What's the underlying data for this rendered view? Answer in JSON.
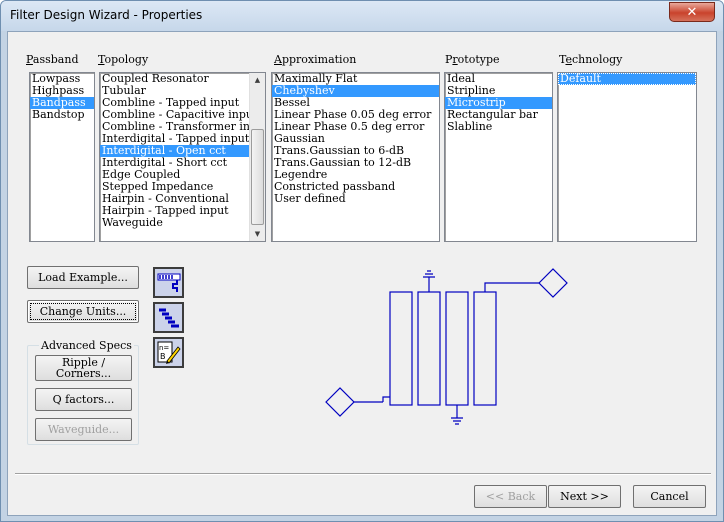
{
  "window": {
    "title": "Filter Design Wizard - Properties",
    "close_glyph": "✕"
  },
  "columns": {
    "passband": {
      "label": "Passband",
      "hotkey": "P",
      "items": [
        "Lowpass",
        "Highpass",
        "Bandpass",
        "Bandstop"
      ],
      "selected": "Bandpass"
    },
    "topology": {
      "label": "Topology",
      "hotkey": "T",
      "items": [
        "Coupled Resonator",
        "Tubular",
        "Combline - Tapped input",
        "Combline - Capacitive input",
        "Combline - Transformer input",
        "Interdigital - Tapped input",
        "Interdigital - Open cct",
        "Interdigital - Short cct",
        "Edge Coupled",
        "Stepped Impedance",
        "Hairpin - Conventional",
        "Hairpin - Tapped input",
        "Waveguide"
      ],
      "selected": "Interdigital - Open cct"
    },
    "approximation": {
      "label": "Approximation",
      "hotkey": "A",
      "items": [
        "Maximally Flat",
        "Chebyshev",
        "Bessel",
        "Linear Phase 0.05 deg error",
        "Linear Phase 0.5 deg error",
        "Gaussian",
        "Trans.Gaussian to 6-dB",
        "Trans.Gaussian to 12-dB",
        "Legendre",
        "Constricted passband",
        "User defined"
      ],
      "selected": "Chebyshev"
    },
    "prototype": {
      "label": "Prototype",
      "hotkey": "r",
      "items": [
        "Ideal",
        "Stripline",
        "Microstrip",
        "Rectangular bar",
        "Slabline"
      ],
      "selected": "Microstrip"
    },
    "technology": {
      "label": "Technology",
      "hotkey": "e",
      "items": [
        "Default"
      ],
      "selected": "Default"
    }
  },
  "buttons": {
    "load_example": "Load Example...",
    "change_units": "Change Units...",
    "ripple_corners_line1": "Ripple /",
    "ripple_corners_line2": "Corners...",
    "q_factors": "Q factors...",
    "waveguide": "Waveguide...",
    "back": "<< Back",
    "next": "Next >>",
    "cancel": "Cancel"
  },
  "advanced_specs": {
    "title": "Advanced Specs"
  },
  "tool_icons": [
    "layout-icon",
    "staircase-icon",
    "edit-pencil-icon"
  ],
  "colors": {
    "selection": "#3399ff",
    "schematic": "#0000c0",
    "title_bar": "#c6d7ea",
    "close_button": "#c9432c"
  }
}
